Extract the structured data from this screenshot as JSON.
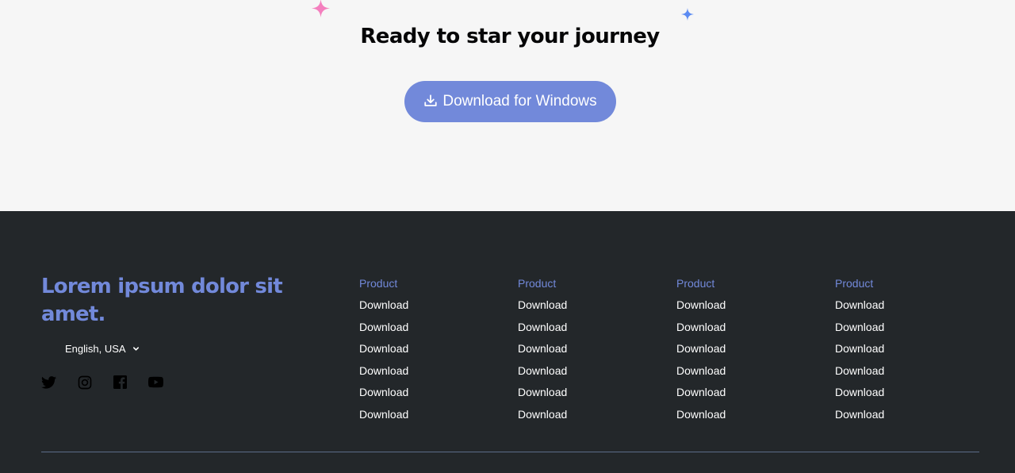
{
  "colors": {
    "blurple": "#7289da",
    "footer_bg": "#23272a",
    "page_bg": "#f6f6f6",
    "sparkle_pink": "#f47fbe",
    "sparkle_blue": "#5c8bf2"
  },
  "cta": {
    "title": "Ready to star your journey",
    "download_label": "Download for Windows",
    "download_icon": "download-icon"
  },
  "footer": {
    "brand_title": "Lorem ipsum dolor sit amet.",
    "language": "English, USA",
    "socials": [
      "twitter-icon",
      "instagram-icon",
      "facebook-icon",
      "youtube-icon"
    ],
    "columns": [
      {
        "header": "Product",
        "links": [
          "Download",
          "Download",
          "Download",
          "Download",
          "Download",
          "Download"
        ]
      },
      {
        "header": "Product",
        "links": [
          "Download",
          "Download",
          "Download",
          "Download",
          "Download",
          "Download"
        ]
      },
      {
        "header": "Product",
        "links": [
          "Download",
          "Download",
          "Download",
          "Download",
          "Download",
          "Download"
        ]
      },
      {
        "header": "Product",
        "links": [
          "Download",
          "Download",
          "Download",
          "Download",
          "Download",
          "Download"
        ]
      }
    ]
  }
}
